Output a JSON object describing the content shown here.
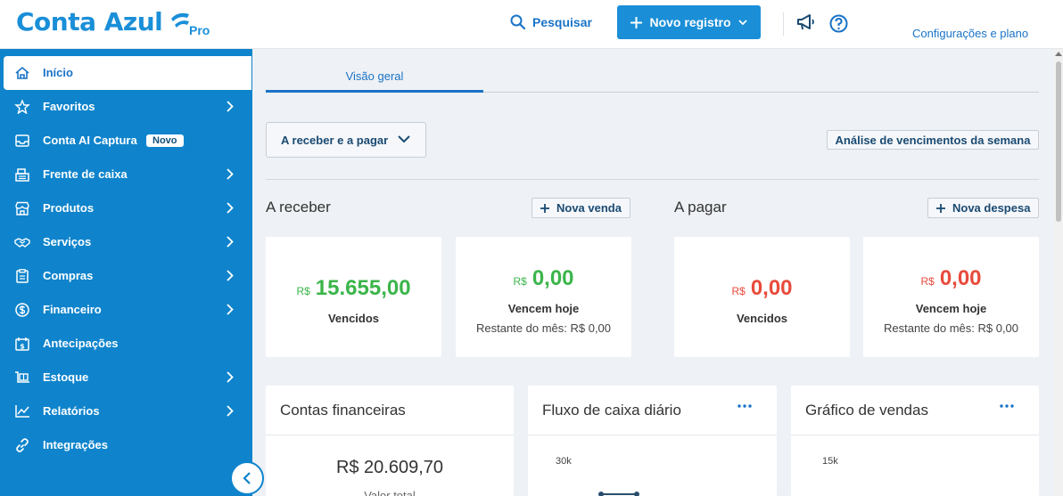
{
  "header": {
    "logo_text": "Conta Azul",
    "logo_badge": "Pro",
    "search_label": "Pesquisar",
    "new_record_label": "Novo registro",
    "settings_label": "Configurações e plano",
    "brand_color": "#1a8fd8"
  },
  "sidebar": {
    "items": [
      {
        "label": "Início",
        "icon": "home-icon",
        "active": true
      },
      {
        "label": "Favoritos",
        "icon": "star-icon",
        "chevron": true
      },
      {
        "label": "Conta AI Captura",
        "icon": "inbox-icon",
        "badge": "Novo"
      },
      {
        "label": "Frente de caixa",
        "icon": "cash-register-icon",
        "chevron": true
      },
      {
        "label": "Produtos",
        "icon": "store-icon",
        "chevron": true
      },
      {
        "label": "Serviços",
        "icon": "handshake-icon",
        "chevron": true
      },
      {
        "label": "Compras",
        "icon": "clipboard-icon",
        "chevron": true
      },
      {
        "label": "Financeiro",
        "icon": "dollar-icon",
        "chevron": true
      },
      {
        "label": "Antecipações",
        "icon": "calendar-money-icon"
      },
      {
        "label": "Estoque",
        "icon": "warehouse-icon",
        "chevron": true
      },
      {
        "label": "Relatórios",
        "icon": "chart-line-icon",
        "chevron": true
      },
      {
        "label": "Integrações",
        "icon": "link-icon"
      }
    ]
  },
  "main": {
    "tab_label": "Visão geral",
    "filter_value": "A receber e a pagar",
    "analysis_button": "Análise de vencimentos da semana",
    "receivable": {
      "title": "A receber",
      "action": "Nova venda",
      "overdue": {
        "currency": "R$",
        "value": "15.655,00",
        "label": "Vencidos"
      },
      "today": {
        "currency": "R$",
        "value": "0,00",
        "label": "Vencem hoje",
        "rest": "Restante do mês: R$ 0,00"
      }
    },
    "payable": {
      "title": "A pagar",
      "action": "Nova despesa",
      "overdue": {
        "currency": "R$",
        "value": "0,00",
        "label": "Vencidos"
      },
      "today": {
        "currency": "R$",
        "value": "0,00",
        "label": "Vencem hoje",
        "rest": "Restante do mês: R$ 0,00"
      }
    },
    "accounts_panel": {
      "title": "Contas financeiras",
      "total": "R$ 20.609,70",
      "total_label": "Valor total"
    },
    "cashflow_panel": {
      "title": "Fluxo de caixa diário",
      "tick": "30k"
    },
    "sales_panel": {
      "title": "Gráfico de vendas",
      "tick": "15k"
    }
  }
}
